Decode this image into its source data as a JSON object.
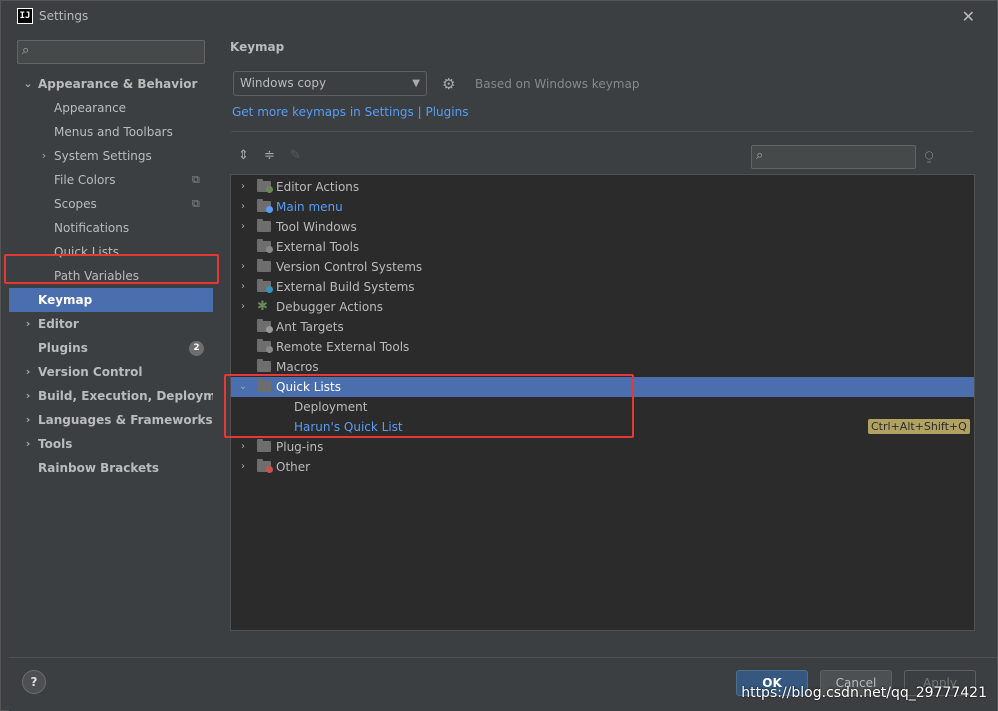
{
  "window": {
    "title": "Settings",
    "app_icon_text": "IJ"
  },
  "sidebar": {
    "search_placeholder": "",
    "items": [
      {
        "label": "Appearance & Behavior",
        "level": 0,
        "arrow": "expanded",
        "bold": true
      },
      {
        "label": "Appearance",
        "level": 1
      },
      {
        "label": "Menus and Toolbars",
        "level": 1
      },
      {
        "label": "System Settings",
        "level": 1,
        "arrow": "collapsed"
      },
      {
        "label": "File Colors",
        "level": 1,
        "copy_icon": true
      },
      {
        "label": "Scopes",
        "level": 1,
        "copy_icon": true
      },
      {
        "label": "Notifications",
        "level": 1
      },
      {
        "label": "Quick Lists",
        "level": 1
      },
      {
        "label": "Path Variables",
        "level": 1
      },
      {
        "label": "Keymap",
        "level": 0,
        "bold": true,
        "selected": true
      },
      {
        "label": "Editor",
        "level": 0,
        "arrow": "collapsed",
        "bold": true
      },
      {
        "label": "Plugins",
        "level": 0,
        "bold": true,
        "badge": "2"
      },
      {
        "label": "Version Control",
        "level": 0,
        "arrow": "collapsed",
        "bold": true
      },
      {
        "label": "Build, Execution, Deployment",
        "level": 0,
        "arrow": "collapsed",
        "bold": true
      },
      {
        "label": "Languages & Frameworks",
        "level": 0,
        "arrow": "collapsed",
        "bold": true
      },
      {
        "label": "Tools",
        "level": 0,
        "arrow": "collapsed",
        "bold": true
      },
      {
        "label": "Rainbow Brackets",
        "level": 0,
        "bold": true
      }
    ]
  },
  "main": {
    "title": "Keymap",
    "keymap_selected": "Windows copy",
    "based_on": "Based on Windows keymap",
    "more_keymaps_link": "Get more keymaps in Settings | Plugins",
    "search_placeholder": "",
    "toolbar_icons": [
      "expand-all-icon",
      "collapse-all-icon",
      "edit-icon"
    ],
    "tree": [
      {
        "label": "Editor Actions",
        "arrow": "collapsed",
        "icon": "folder-edit"
      },
      {
        "label": "Main menu",
        "arrow": "collapsed",
        "icon": "folder-menu",
        "link": true
      },
      {
        "label": "Tool Windows",
        "arrow": "collapsed",
        "icon": "folder"
      },
      {
        "label": "External Tools",
        "icon": "folder-ext"
      },
      {
        "label": "Version Control Systems",
        "arrow": "collapsed",
        "icon": "folder"
      },
      {
        "label": "External Build Systems",
        "arrow": "collapsed",
        "icon": "folder-build"
      },
      {
        "label": "Debugger Actions",
        "arrow": "collapsed",
        "icon": "bug"
      },
      {
        "label": "Ant Targets",
        "icon": "folder-ant"
      },
      {
        "label": "Remote External Tools",
        "icon": "folder-ext"
      },
      {
        "label": "Macros",
        "icon": "folder"
      },
      {
        "label": "Quick Lists",
        "arrow": "expanded",
        "icon": "folder",
        "selected": true
      },
      {
        "label": "Deployment",
        "child": true
      },
      {
        "label": "Harun's Quick List",
        "child": true,
        "link": true,
        "shortcut": "Ctrl+Alt+Shift+Q"
      },
      {
        "label": "Plug-ins",
        "arrow": "collapsed",
        "icon": "folder"
      },
      {
        "label": "Other",
        "arrow": "collapsed",
        "icon": "folder-other"
      }
    ]
  },
  "buttons": {
    "help": "?",
    "ok": "OK",
    "cancel": "Cancel",
    "apply": "Apply"
  },
  "watermark": "https://blog.csdn.net/qq_29777421",
  "colors": {
    "selection": "#4b6eaf",
    "link": "#589df6",
    "highlight_box": "#e53935",
    "shortcut_bg": "#b1a262"
  }
}
